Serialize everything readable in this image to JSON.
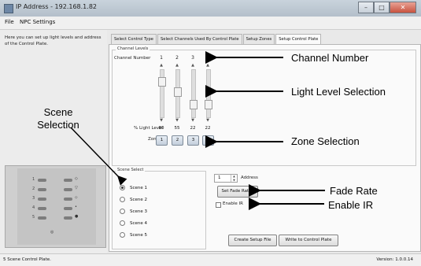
{
  "window": {
    "title": "IP Address - 192.168.1.82",
    "controls": [
      "–",
      "□",
      "✕"
    ]
  },
  "menu": [
    "File",
    "NPC Settings"
  ],
  "info_text": "Here you can set up light levels and address of the Control Plate.",
  "tabs": [
    "Select Control Type",
    "Select Channels Used By Control Plate",
    "Setup Zones",
    "Setup Control Plate"
  ],
  "channel_levels": {
    "label": "Channel Levels",
    "channel_number_label": "Channel Number",
    "light_level_label": "% Light Level",
    "zone_label": "Zone",
    "channels": [
      {
        "number": "1",
        "level": "80",
        "zone": "1",
        "level_pct": 80
      },
      {
        "number": "2",
        "level": "55",
        "zone": "2",
        "level_pct": 55
      },
      {
        "number": "3",
        "level": "22",
        "zone": "3",
        "level_pct": 22
      },
      {
        "number": "4",
        "level": "22",
        "zone": "3",
        "level_pct": 22
      }
    ]
  },
  "scene_select": {
    "label": "Scene Select",
    "scenes": [
      "Scene 1",
      "Scene 2",
      "Scene 3",
      "Scene 4",
      "Scene 5"
    ],
    "selected": "Scene 1"
  },
  "address": {
    "value": "1",
    "label": "Address"
  },
  "buttons": {
    "set_fade_rates": "Set Fade Rates",
    "create_setup_file": "Create Setup File",
    "write_to_control_plate": "Write to Control Plate"
  },
  "enable_ir": {
    "label": "Enable IR",
    "checked": false
  },
  "control_plate": {
    "rows": [
      "1",
      "2",
      "3",
      "4",
      "5"
    ],
    "glyphs": [
      "◇",
      "▽",
      "⬦",
      "•",
      "●",
      "◎"
    ]
  },
  "status": {
    "left": "5 Scene Control Plate.",
    "right": "Version: 1.0.0.14"
  },
  "callouts": {
    "channel_number": "Channel Number",
    "light_level_selection": "Light Level Selection",
    "zone_selection": "Zone Selection",
    "scene_selection": "Scene Selection",
    "fade_rate": "Fade Rate",
    "enable_ir": "Enable IR"
  }
}
